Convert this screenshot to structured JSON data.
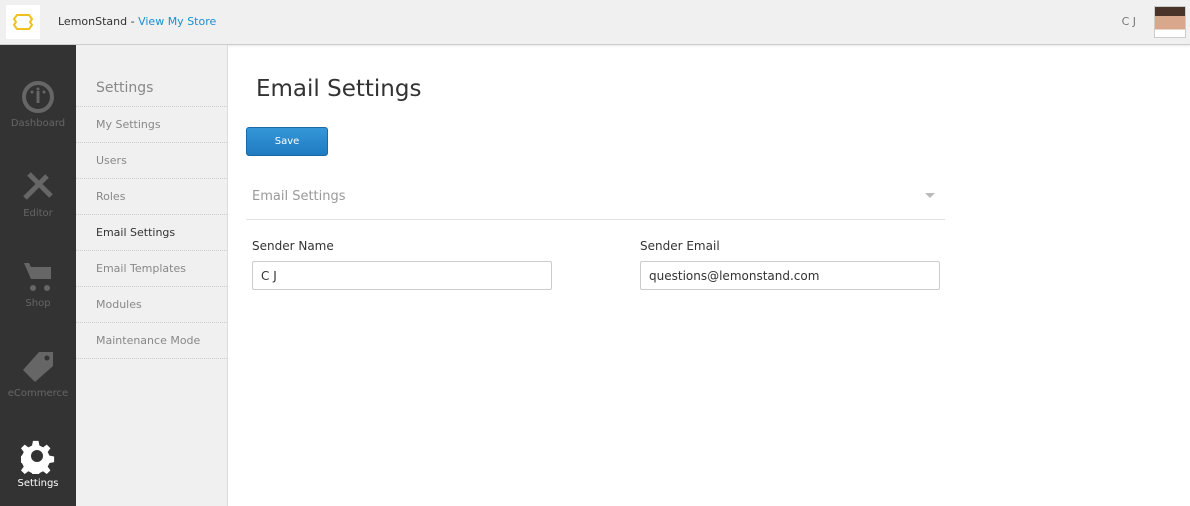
{
  "header": {
    "brand": "LemonStand",
    "separator": " - ",
    "store_link": "View My Store",
    "user": "C J"
  },
  "rail": [
    {
      "label": "Dashboard",
      "icon": "gauge-icon"
    },
    {
      "label": "Editor",
      "icon": "tools-icon"
    },
    {
      "label": "Shop",
      "icon": "cart-icon"
    },
    {
      "label": "eCommerce",
      "icon": "tag-icon"
    },
    {
      "label": "Settings",
      "icon": "gear-icon",
      "active": true
    }
  ],
  "subnav": {
    "title": "Settings",
    "items": [
      "My Settings",
      "Users",
      "Roles",
      "Email Settings",
      "Email Templates",
      "Modules",
      "Maintenance Mode"
    ],
    "active": "Email Settings"
  },
  "main": {
    "title": "Email Settings",
    "save": "Save",
    "section": "Email Settings",
    "sender_name": {
      "label": "Sender Name",
      "value": "C J"
    },
    "sender_email": {
      "label": "Sender Email",
      "value": "questions@lemonstand.com"
    }
  }
}
